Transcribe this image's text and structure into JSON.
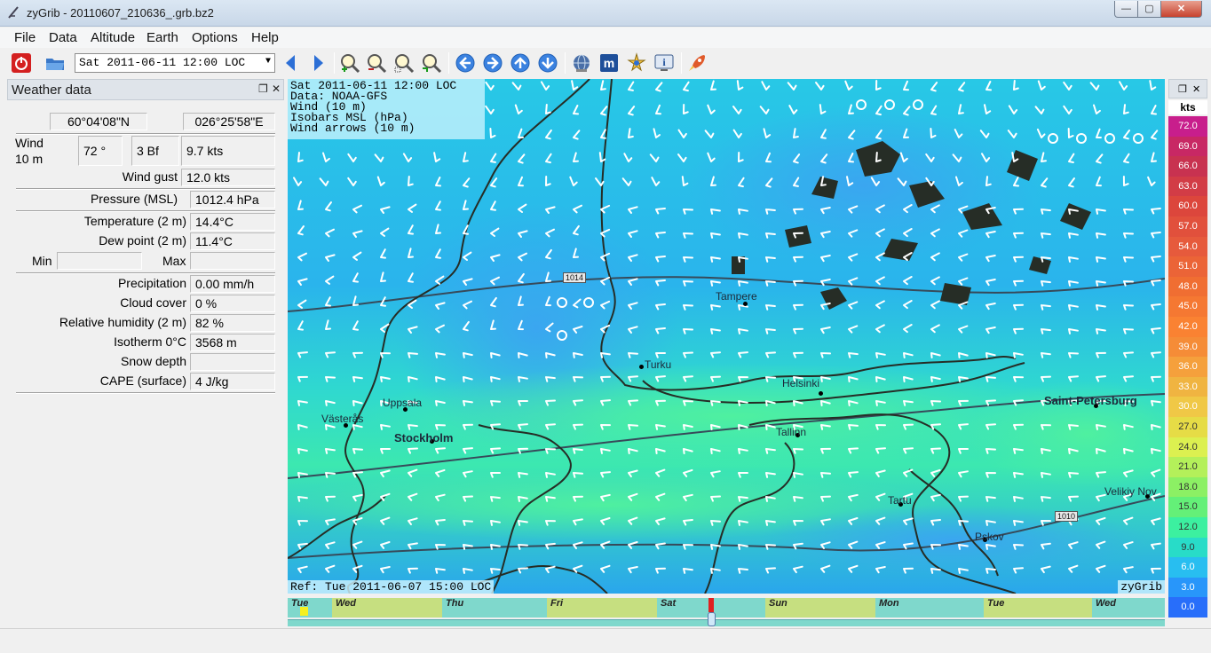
{
  "window": {
    "title": "zyGrib - 20110607_210636_.grb.bz2"
  },
  "menu": [
    "File",
    "Data",
    "Altitude",
    "Earth",
    "Options",
    "Help"
  ],
  "toolbar": {
    "date_selected": "Sat 2011-06-11 12:00 LOC"
  },
  "panel": {
    "title": "Weather data",
    "lat": "60°04'08\"N",
    "lon": "026°25'58\"E",
    "wind_label": "Wind",
    "wind_sub": "10 m",
    "wind_dir": "72 °",
    "wind_bf": "3 Bf",
    "wind_kts": "9.7  kts",
    "gust_label": "Wind gust",
    "gust_value": "12.0  kts",
    "pressure_label": "Pressure (MSL)",
    "pressure_value": "1012.4 hPa",
    "temp_label": "Temperature (2 m)",
    "temp_value": "14.4°C",
    "dew_label": "Dew point (2 m)",
    "dew_value": "11.4°C",
    "min_label": "Min",
    "max_label": "Max",
    "precip_label": "Precipitation",
    "precip_value": "0.00 mm/h",
    "cloud_label": "Cloud cover",
    "cloud_value": " 0 %",
    "humidity_label": "Relative humidity (2 m)",
    "humidity_value": " 82 %",
    "isotherm_label": "Isotherm 0°C",
    "isotherm_value": "3568 m",
    "snow_label": "Snow depth",
    "snow_value": "",
    "cape_label": "CAPE (surface)",
    "cape_value": "4 J/kg"
  },
  "map": {
    "info_lines": [
      "Sat 2011-06-11 12:00 LOC",
      "Data: NOAA-GFS",
      "Wind (10 m)",
      "Isobars MSL (hPa)",
      "Wind arrows (10 m)"
    ],
    "ref": "Ref: Tue 2011-06-07 15:00 LOC",
    "brand": "zyGrib",
    "cities": [
      "Tampere",
      "Turku",
      "Helsinki",
      "Saint-Petersburg",
      "Uppsala",
      "Västerås",
      "Stockholm",
      "Tallinn",
      "Tartu",
      "Velikiy Nov",
      "Pskov"
    ],
    "isobars": [
      "1014",
      "1010"
    ]
  },
  "timeline": {
    "days": [
      "Tue",
      "Wed",
      "Thu",
      "Fri",
      "Sat",
      "Sun",
      "Mon",
      "Tue",
      "Wed"
    ]
  },
  "legend": {
    "unit": "kts",
    "values": [
      "72.0",
      "69.0",
      "66.0",
      "63.0",
      "60.0",
      "57.0",
      "54.0",
      "51.0",
      "48.0",
      "45.0",
      "42.0",
      "39.0",
      "36.0",
      "33.0",
      "30.0",
      "27.0",
      "24.0",
      "21.0",
      "18.0",
      "15.0",
      "12.0",
      "9.0",
      "6.0",
      "3.0",
      "0.0"
    ],
    "colors": [
      "#c81e8c",
      "#c82864",
      "#c83250",
      "#d23c46",
      "#dc463c",
      "#e1503c",
      "#e65a3c",
      "#eb6437",
      "#f06e32",
      "#f57832",
      "#fa8232",
      "#f58c37",
      "#f5a03c",
      "#f0b441",
      "#f0c846",
      "#e6dc46",
      "#dcf050",
      "#b4f05a",
      "#8cf064",
      "#64f078",
      "#3cf0a0",
      "#28dcc8",
      "#28bef0",
      "#2896fa",
      "#286efa"
    ]
  }
}
